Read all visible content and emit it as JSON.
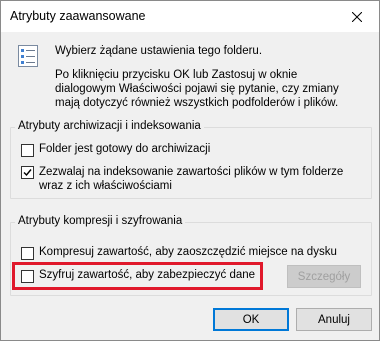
{
  "window": {
    "title": "Atrybuty zaawansowane"
  },
  "intro": {
    "line1": "Wybierz żądane ustawienia tego folderu.",
    "line2": "Po kliknięciu przycisku OK lub Zastosuj w oknie dialogowym Właściwości pojawi się pytanie, czy zmiany mają dotyczyć również wszystkich podfolderów i plików."
  },
  "archive_group": {
    "label": "Atrybuty archiwizacji i indeksowania",
    "folder_ready": {
      "label": "Folder jest gotowy do archiwizacji",
      "checked": false
    },
    "allow_indexing": {
      "label": "Zezwalaj na indeksowanie zawartości plików w tym folderze wraz z ich właściwościami",
      "checked": true
    }
  },
  "compress_group": {
    "label": "Atrybuty kompresji i szyfrowania",
    "compress": {
      "label": "Kompresuj zawartość, aby zaoszczędzić miejsce na dysku",
      "checked": false
    },
    "encrypt": {
      "label": "Szyfruj zawartość, aby zabezpieczyć dane",
      "checked": false
    },
    "details_label": "Szczegóły"
  },
  "buttons": {
    "ok": "OK",
    "cancel": "Anuluj"
  },
  "icons": {
    "close": "close-icon",
    "info": "properties-list-icon",
    "check": "checkmark-icon"
  },
  "colors": {
    "highlight": "#e0182b",
    "accent": "#0078d7"
  }
}
